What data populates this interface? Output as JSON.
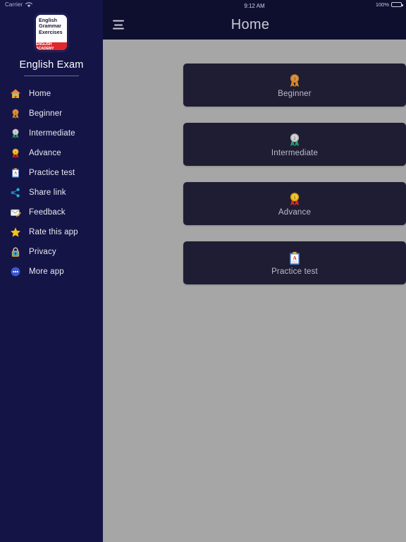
{
  "status_bar": {
    "carrier": "Carrier",
    "wifi_icon": "wifi-icon",
    "time": "9:12 AM",
    "battery_percent": "100%",
    "battery_icon": "battery-full-icon"
  },
  "sidebar": {
    "logo": {
      "icon_name": "app-logo-icon",
      "line1": "English",
      "line2": "Grammar",
      "line3": "Exercises",
      "band": "ENGLISH ACADEMY"
    },
    "app_title": "English Exam",
    "items": [
      {
        "label": "Home",
        "icon": "house-icon"
      },
      {
        "label": "Beginner",
        "icon": "bronze-medal-icon"
      },
      {
        "label": "Intermediate",
        "icon": "silver-medal-icon"
      },
      {
        "label": "Advance",
        "icon": "gold-medal-icon"
      },
      {
        "label": "Practice test",
        "icon": "clipboard-grade-icon"
      },
      {
        "label": "Share link",
        "icon": "share-nodes-icon"
      },
      {
        "label": "Feedback",
        "icon": "memo-envelope-icon"
      },
      {
        "label": "Rate this app",
        "icon": "star-icon"
      },
      {
        "label": "Privacy",
        "icon": "lock-icon"
      },
      {
        "label": "More app",
        "icon": "more-dots-icon"
      }
    ]
  },
  "navbar": {
    "menu_icon": "hamburger-menu-icon",
    "title": "Home"
  },
  "cards": [
    {
      "label": "Beginner",
      "icon": "bronze-medal-icon"
    },
    {
      "label": "Intermediate",
      "icon": "silver-medal-icon"
    },
    {
      "label": "Advance",
      "icon": "gold-medal-icon"
    },
    {
      "label": "Practice test",
      "icon": "clipboard-grade-icon"
    }
  ],
  "colors": {
    "sidebar_bg": "#151446",
    "navbar_bg": "#0e0e2e",
    "content_bg": "#a6a6a6",
    "card_bg": "#1e1d33",
    "logo_band": "#e1262c"
  }
}
